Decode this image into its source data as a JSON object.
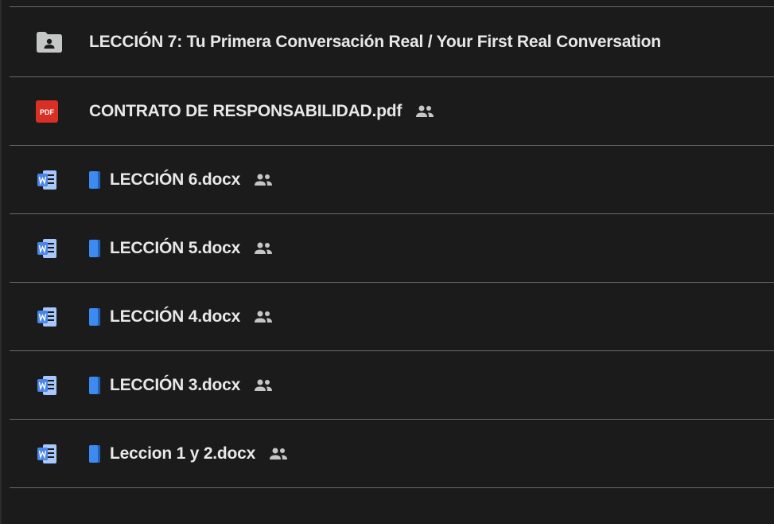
{
  "files": [
    {
      "type": "shared-folder",
      "icon": "shared-folder-icon",
      "book_emoji": false,
      "name": "LECCIÓN 7: Tu Primera Conversación Real / Your First Real Conversation",
      "shared": false
    },
    {
      "type": "pdf",
      "icon": "pdf-icon",
      "book_emoji": false,
      "name": "CONTRATO DE RESPONSABILIDAD.pdf",
      "shared": true
    },
    {
      "type": "docx",
      "icon": "word-doc-icon",
      "book_emoji": true,
      "name": "LECCIÓN 6.docx",
      "shared": true
    },
    {
      "type": "docx",
      "icon": "word-doc-icon",
      "book_emoji": true,
      "name": "LECCIÓN 5.docx",
      "shared": true
    },
    {
      "type": "docx",
      "icon": "word-doc-icon",
      "book_emoji": true,
      "name": "LECCIÓN 4.docx",
      "shared": true
    },
    {
      "type": "docx",
      "icon": "word-doc-icon",
      "book_emoji": true,
      "name": "LECCIÓN 3.docx",
      "shared": true
    },
    {
      "type": "docx",
      "icon": "word-doc-icon",
      "book_emoji": true,
      "name": "Leccion 1 y 2.docx",
      "shared": true
    }
  ],
  "pdf_badge_text": "PDF",
  "colors": {
    "background": "#1b1b1b",
    "divider": "#6a6a6a",
    "text": "#e8e8e8",
    "pdf_red": "#d93025",
    "word_blue": "#4a86e8",
    "book_blue": "#3d8bf0",
    "folder_gray": "#c4c7c5"
  }
}
